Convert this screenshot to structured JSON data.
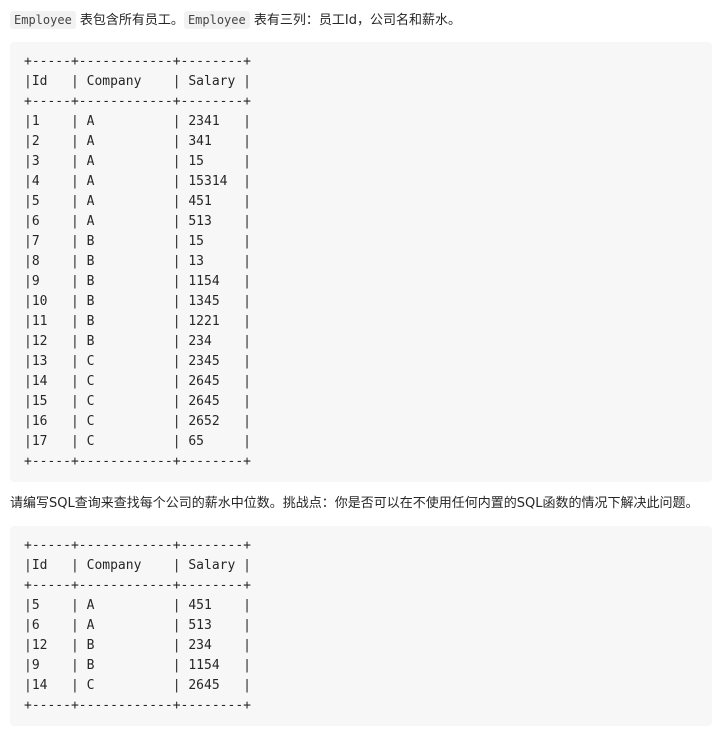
{
  "intro": {
    "code1": "Employee",
    "text1": " 表包含所有员工。",
    "code2": "Employee",
    "text2": " 表有三列：员工Id，公司名和薪水。"
  },
  "employee_table": {
    "border": "+-----+------------+--------+",
    "headers": [
      "Id",
      "Company",
      "Salary"
    ],
    "rows": [
      [
        "1",
        "A",
        "2341"
      ],
      [
        "2",
        "A",
        "341"
      ],
      [
        "3",
        "A",
        "15"
      ],
      [
        "4",
        "A",
        "15314"
      ],
      [
        "5",
        "A",
        "451"
      ],
      [
        "6",
        "A",
        "513"
      ],
      [
        "7",
        "B",
        "15"
      ],
      [
        "8",
        "B",
        "13"
      ],
      [
        "9",
        "B",
        "1154"
      ],
      [
        "10",
        "B",
        "1345"
      ],
      [
        "11",
        "B",
        "1221"
      ],
      [
        "12",
        "B",
        "234"
      ],
      [
        "13",
        "C",
        "2345"
      ],
      [
        "14",
        "C",
        "2645"
      ],
      [
        "15",
        "C",
        "2645"
      ],
      [
        "16",
        "C",
        "2652"
      ],
      [
        "17",
        "C",
        "65"
      ]
    ]
  },
  "question": "请编写SQL查询来查找每个公司的薪水中位数。挑战点：你是否可以在不使用任何内置的SQL函数的情况下解决此问题。",
  "result_table": {
    "border": "+-----+------------+--------+",
    "headers": [
      "Id",
      "Company",
      "Salary"
    ],
    "rows": [
      [
        "5",
        "A",
        "451"
      ],
      [
        "6",
        "A",
        "513"
      ],
      [
        "12",
        "B",
        "234"
      ],
      [
        "9",
        "B",
        "1154"
      ],
      [
        "14",
        "C",
        "2645"
      ]
    ]
  }
}
